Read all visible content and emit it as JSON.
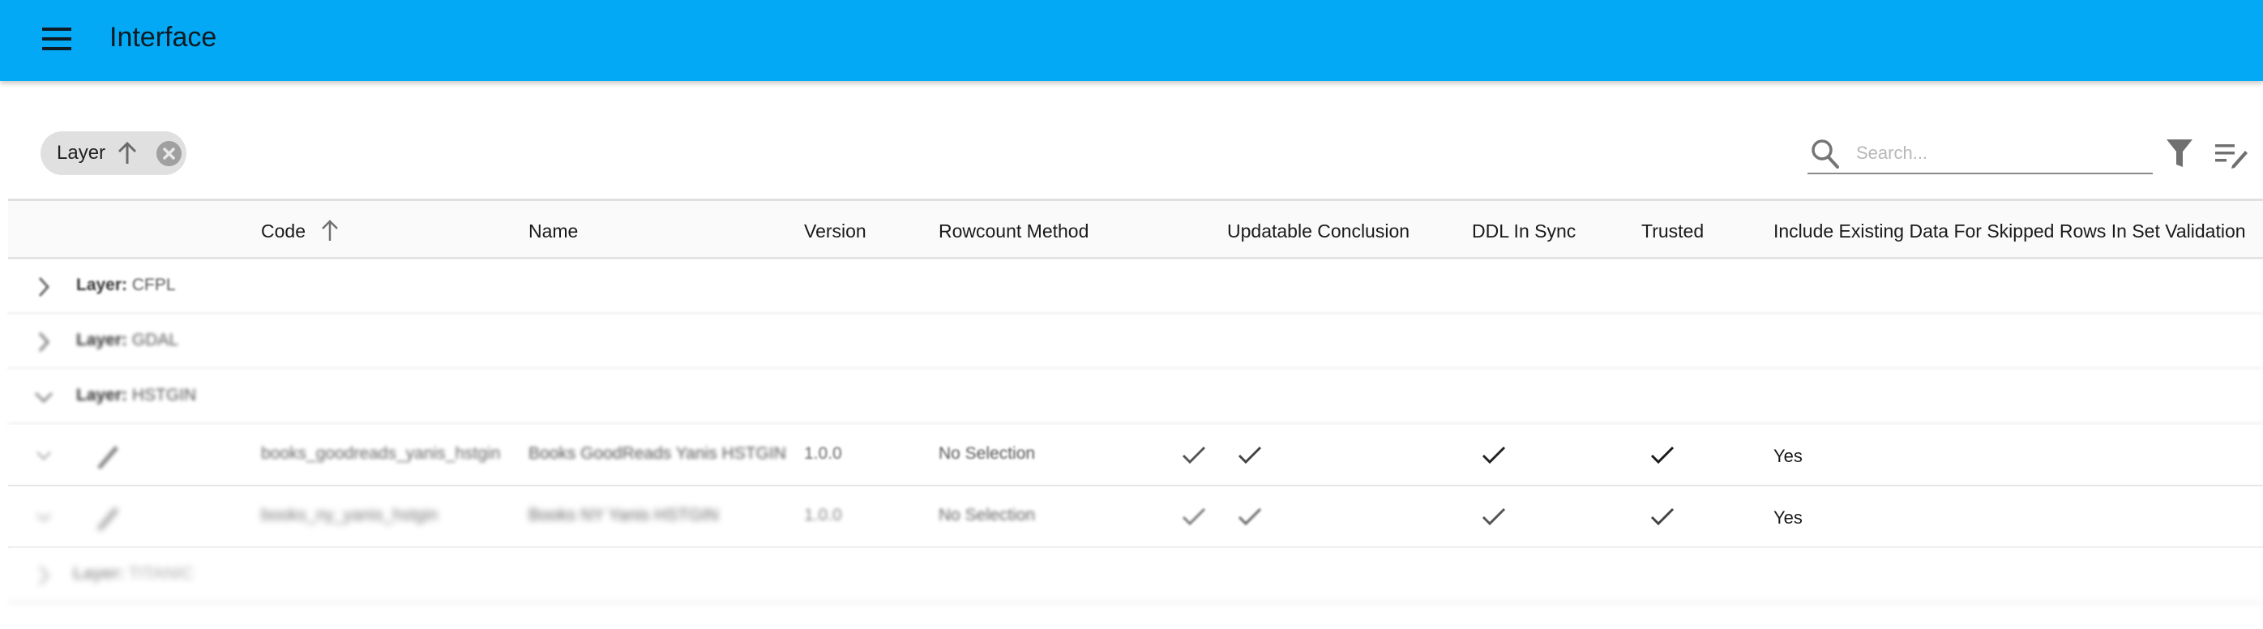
{
  "app": {
    "title": "Interface",
    "menu_icon": "hamburger-menu-icon",
    "brand_color": "#03a9f4"
  },
  "toolbar": {
    "group_chip": {
      "label": "Layer",
      "sort_icon": "arrow-up-icon",
      "remove_icon": "cancel-circle-icon"
    },
    "search": {
      "placeholder": "Search...",
      "value": ""
    },
    "filter_icon": "filter-icon",
    "columns_icon": "edit-list-icon"
  },
  "table": {
    "columns": [
      {
        "key": "code",
        "label": "Code",
        "sorted": "asc"
      },
      {
        "key": "name",
        "label": "Name"
      },
      {
        "key": "version",
        "label": "Version"
      },
      {
        "key": "rowcount_method",
        "label": "Rowcount Method"
      },
      {
        "key": "updatable_conclusion",
        "label": "Updatable Conclusion"
      },
      {
        "key": "ddl_in_sync",
        "label": "DDL In Sync"
      },
      {
        "key": "trusted",
        "label": "Trusted"
      },
      {
        "key": "include_existing",
        "label": "Include Existing Data For Skipped Rows In Set Validation"
      }
    ],
    "groups": [
      {
        "prefix": "Layer:",
        "value": "CFPL",
        "expanded": false
      },
      {
        "prefix": "Layer:",
        "value": "GDAL",
        "expanded": false
      },
      {
        "prefix": "Layer:",
        "value": "HSTGIN",
        "expanded": true,
        "rows": [
          {
            "code": "books_goodreads_yanis_hstgin",
            "name": "Books GoodReads Yanis HSTGIN",
            "version": "1.0.0",
            "rowcount_method": "No Selection",
            "active": true,
            "updatable_conclusion": true,
            "ddl_in_sync": true,
            "trusted": true,
            "include_existing": "Yes"
          },
          {
            "code": "books_ny_yanis_hstgin",
            "name": "Books NY Yanis HSTGIN",
            "version": "1.0.0",
            "rowcount_method": "No Selection",
            "active": true,
            "updatable_conclusion": true,
            "ddl_in_sync": true,
            "trusted": true,
            "include_existing": "Yes"
          }
        ]
      },
      {
        "prefix": "Layer:",
        "value": "TITANIC",
        "expanded": false
      }
    ]
  }
}
